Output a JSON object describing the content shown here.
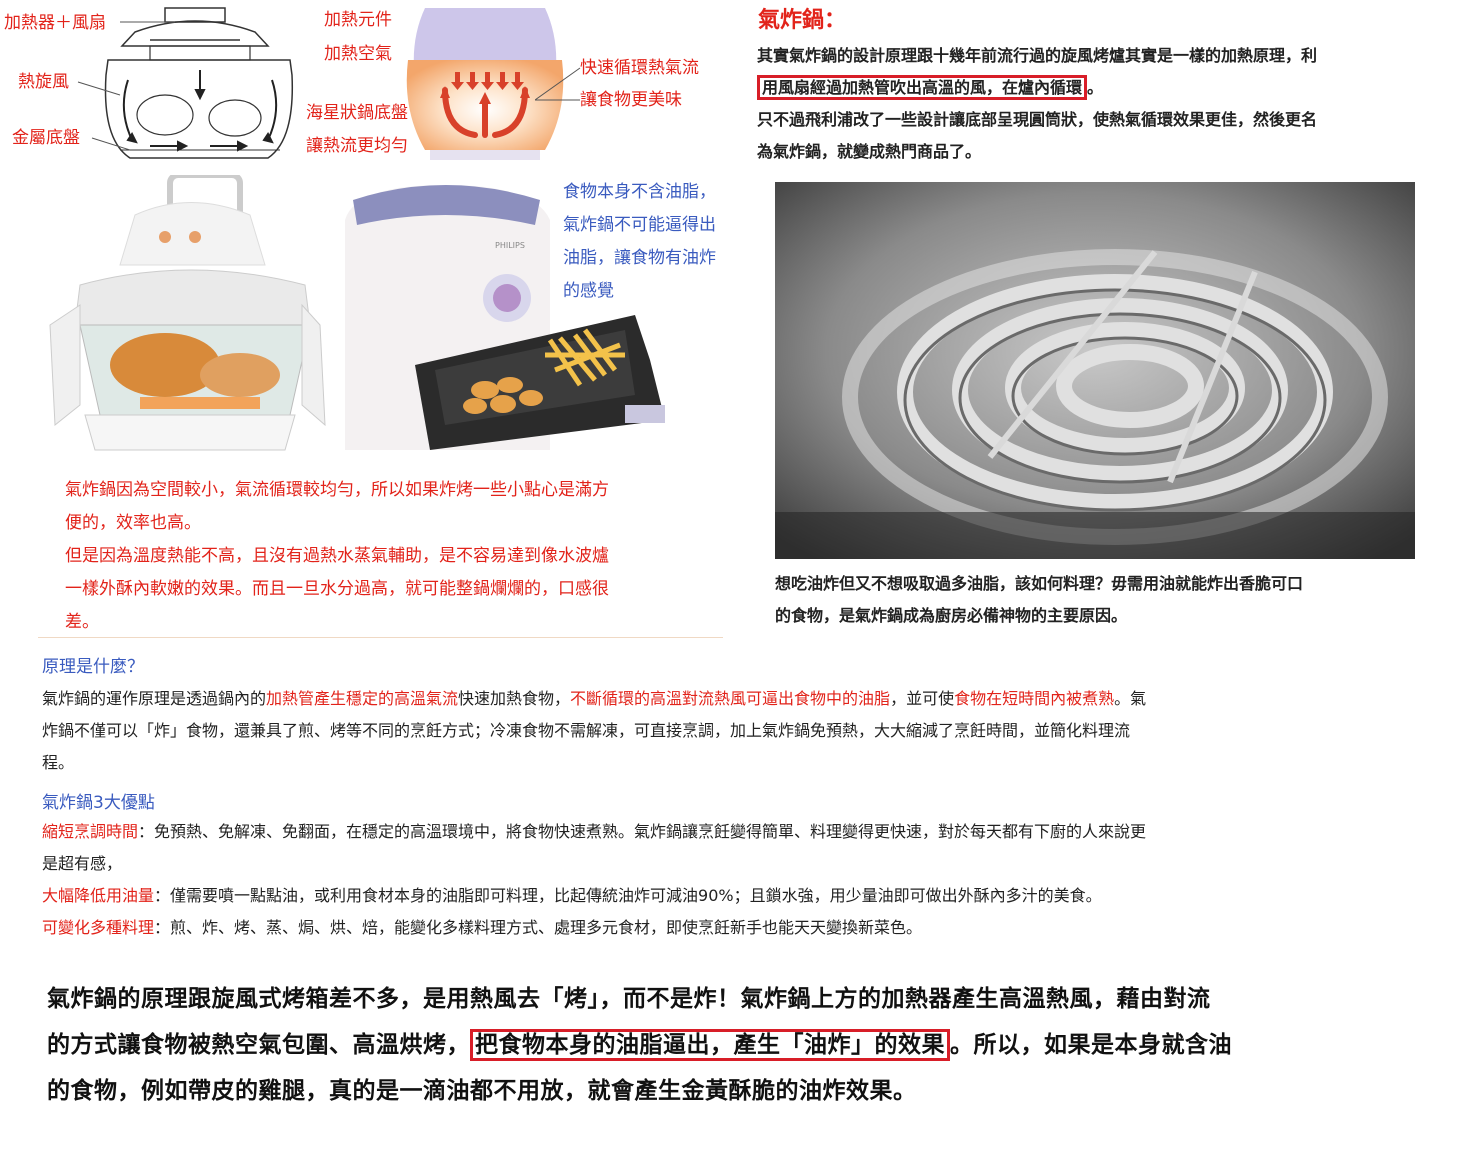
{
  "diagram1": {
    "labels": {
      "heater_fan": "加熱器＋風扇",
      "hot_wind": "熱旋風",
      "metal_tray": "金屬底盤"
    }
  },
  "diagram2": {
    "labels": {
      "heating_element": "加熱元件",
      "heated_air": "加熱空氣",
      "fast_circulation": "快速循環熱氣流",
      "tastier_food": "讓食物更美味",
      "starfish_bottom": "海星狀鍋底盤",
      "even_heat": "讓熱流更均勻"
    }
  },
  "airfryer_note": {
    "lines": [
      "食物本身不含油脂，",
      "氣炸鍋不可能逼得出",
      "油脂，讓食物有油炸",
      "的感覺"
    ]
  },
  "airfryer_brand": "PHILIPS",
  "right_column": {
    "title": "氣炸鍋：",
    "para_a_1": "其實氣炸鍋的設計原理跟十幾年前流行過的旋風烤爐其實是一樣的加熱原理，利",
    "para_a_boxed": "用風扇經過加熱管吹出高溫的風，在爐內循環",
    "para_a_end": "。",
    "para_b_1": "只不過飛利浦改了一些設計讓底部呈現圓筒狀，使熱氣循環效果更佳，然後更名",
    "para_b_2": "為氣炸鍋，就變成熱門商品了。",
    "caption_1": "想吃油炸但又不想吸取過多油脂，該如何料理？毋需用油就能炸出香脆可口",
    "caption_2": "的食物，是氣炸鍋成為廚房必備神物的主要原因。"
  },
  "left_red_text": {
    "lines": [
      "氣炸鍋因為空間較小，氣流循環較均勻，所以如果炸烤一些小點心是滿方",
      "便的，效率也高。",
      "但是因為溫度熱能不高，且沒有過熱水蒸氣輔助，是不容易達到像水波爐",
      "一樣外酥內軟嫩的效果。而且一旦水分過高，就可能整鍋爛爛的，口感很",
      "差。"
    ]
  },
  "principle": {
    "heading": "原理是什麼？",
    "l1_a": "氣炸鍋的運作原理是透過鍋內的",
    "l1_red1": "加熱管產生穩定的高溫氣流",
    "l1_b": "快速加熱食物，",
    "l1_red2": "不斷循環的高溫對流熱風可逼出食物中的油脂",
    "l1_c": "，並可使",
    "l1_red3": "食物在短時間內被煮熟",
    "l1_d": "。氣",
    "l2": "炸鍋不僅可以「炸」食物，還兼具了煎、烤等不同的烹飪方式；冷凍食物不需解凍，可直接烹調，加上氣炸鍋免預熱，大大縮減了烹飪時間，並簡化料理流",
    "l3": "程。"
  },
  "advantages": {
    "heading": "氣炸鍋3大優點",
    "items": [
      {
        "title": "縮短烹調時間",
        "text": "：免預熱、免解凍、免翻面，在穩定的高溫環境中，將食物快速煮熟。氣炸鍋讓烹飪變得簡單、料理變得更快速，對於每天都有下廚的人來說更",
        "text2": "是超有感，"
      },
      {
        "title": "大幅降低用油量",
        "text": "：僅需要噴一點點油，或利用食材本身的油脂即可料理，比起傳統油炸可減油90%；且鎖水強，用少量油即可做出外酥內多汁的美食。",
        "text2": ""
      },
      {
        "title": "可變化多種料理",
        "text": "：煎、炸、烤、蒸、焗、烘、焙，能變化多樣料理方式、處理多元食材，即使烹飪新手也能天天變換新菜色。",
        "text2": ""
      }
    ]
  },
  "summary": {
    "l1": "氣炸鍋的原理跟旋風式烤箱差不多，是用熱風去「烤」，而不是炸！氣炸鍋上方的加熱器產生高溫熱風，藉由對流",
    "l2_a": "的方式讓食物被熱空氣包圍、高溫烘烤，",
    "l2_boxed": "把食物本身的油脂逼出，產生「油炸」的效果",
    "l2_b": "。所以，如果是本身就含油",
    "l3": "的食物，例如帶皮的雞腿，真的是一滴油都不用放，就會產生金黃酥脆的油炸效果。"
  },
  "colors": {
    "accent_red": "#e2231a",
    "accent_blue": "#3a5bbf",
    "box_red": "#d81e28"
  }
}
